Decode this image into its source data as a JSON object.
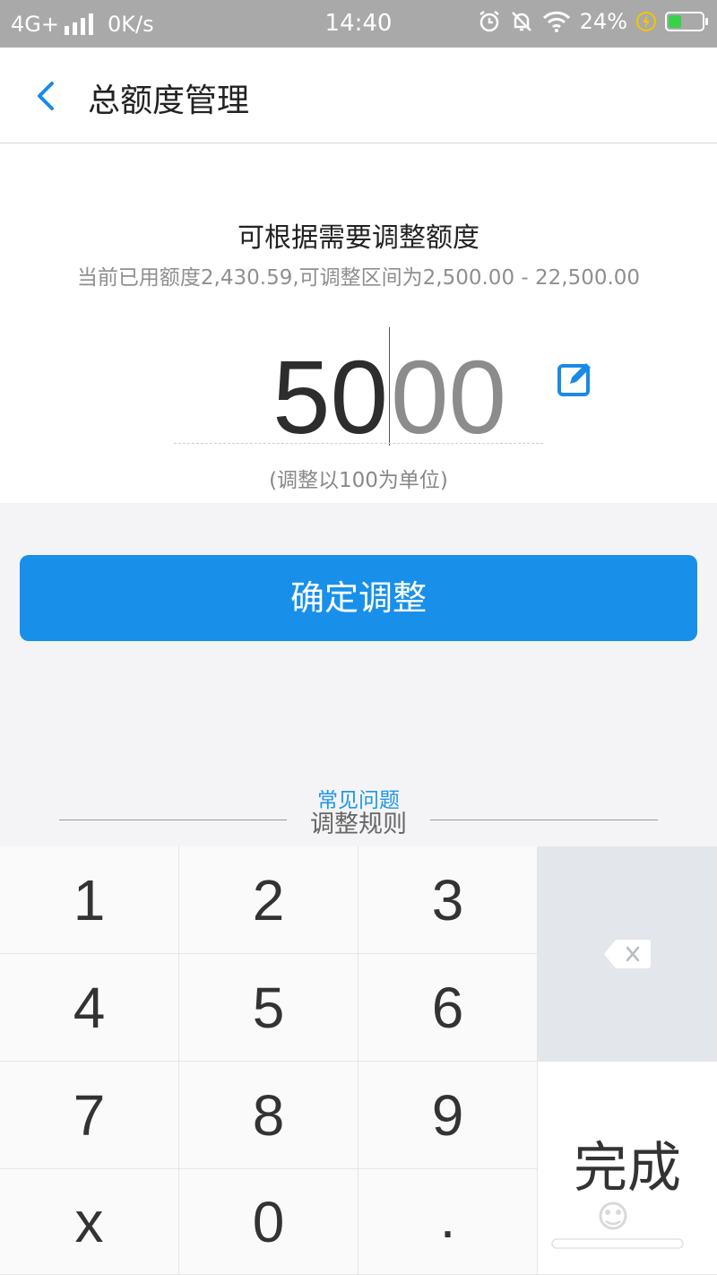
{
  "status_bar": {
    "network": "4G+",
    "speed": "0K/s",
    "time": "14:40",
    "battery_percent": "24%",
    "icons": [
      "signal-icon",
      "alarm-icon",
      "mute-bell-icon",
      "wifi-icon",
      "charging-icon",
      "battery-icon"
    ],
    "battery_fill_fraction": 0.24
  },
  "header": {
    "back_icon": "chevron-left-icon",
    "title": "总额度管理"
  },
  "adjust": {
    "heading": "可根据需要调整额度",
    "subheading": "当前已用额度2,430.59,可调整区间为2,500.00 - 22,500.00",
    "amount_typed": "50",
    "amount_ghost": "00",
    "edit_icon": "edit-icon",
    "hint": "(调整以100为单位)"
  },
  "confirm_button": "确定调整",
  "links": {
    "faq": "常见问题",
    "rules": "调整规则"
  },
  "keypad": {
    "keys": [
      "1",
      "2",
      "3",
      "4",
      "5",
      "6",
      "7",
      "8",
      "9",
      "x",
      "0",
      "."
    ],
    "delete_icon": "backspace-icon",
    "done": "完成"
  },
  "colors": {
    "accent": "#1890ea",
    "status_bar": "#a9a9a9",
    "delete_key_bg": "#e3e6eb"
  }
}
